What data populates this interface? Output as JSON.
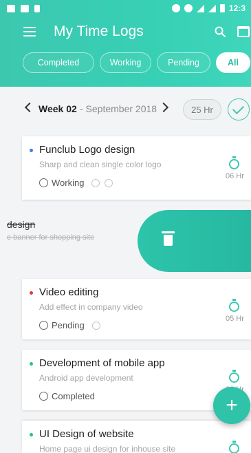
{
  "status_bar": {
    "time": "12:3"
  },
  "app_bar": {
    "title": "My Time Logs"
  },
  "filters": [
    {
      "label": "Completed",
      "active": false
    },
    {
      "label": "Working",
      "active": false
    },
    {
      "label": "Pending",
      "active": false
    },
    {
      "label": "All",
      "active": true
    }
  ],
  "week": {
    "label": "Week 02",
    "subtitle": "- September 2018",
    "total_hours": "25 Hr"
  },
  "tasks": [
    {
      "title": "Funclub Logo design",
      "description": "Sharp and clean single color logo",
      "status": "Working",
      "hours": "06 Hr",
      "dot_color": "#3b7fe0"
    },
    {
      "title": "Video editing",
      "description": "Add effect in company video",
      "status": "Pending",
      "hours": "05 Hr",
      "dot_color": "#e53935"
    },
    {
      "title": "Development of mobile app",
      "description": "Android app development",
      "status": "Completed",
      "hours": "06 Hr",
      "dot_color": "#2bbf85"
    },
    {
      "title": "UI Design of website",
      "description": "Home page ui design for inhouse site",
      "status": "",
      "hours": "",
      "dot_color": "#2bbf85"
    }
  ],
  "swiped_task": {
    "title": "design",
    "description": "e banner for shopping site"
  },
  "fab": {
    "label": "+"
  }
}
